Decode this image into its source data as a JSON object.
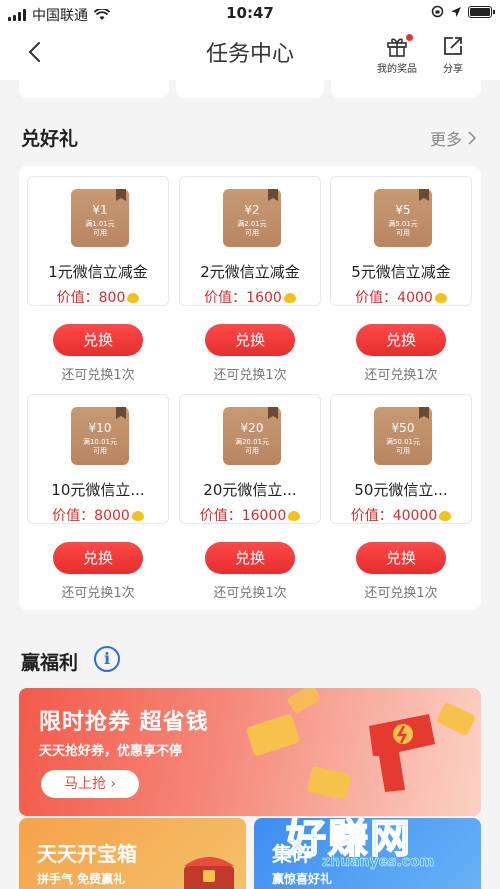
{
  "status_bar": {
    "carrier": "中国联通",
    "time": "10:47"
  },
  "nav": {
    "title": "任务中心",
    "prizes_label": "我的奖品",
    "share_label": "分享"
  },
  "gifts_section": {
    "title": "兑好礼",
    "more_label": "更多",
    "items": [
      {
        "coupon_amount": "¥1",
        "coupon_sub1": "满1.01元",
        "coupon_sub2": "可用",
        "name": "1元微信立减金",
        "value_label": "价值：800",
        "button": "兑换",
        "remaining": "还可兑换1次"
      },
      {
        "coupon_amount": "¥2",
        "coupon_sub1": "满2.01元",
        "coupon_sub2": "可用",
        "name": "2元微信立减金",
        "value_label": "价值：1600",
        "button": "兑换",
        "remaining": "还可兑换1次"
      },
      {
        "coupon_amount": "¥5",
        "coupon_sub1": "满5.01元",
        "coupon_sub2": "可用",
        "name": "5元微信立减金",
        "value_label": "价值：4000",
        "button": "兑换",
        "remaining": "还可兑换1次"
      },
      {
        "coupon_amount": "¥10",
        "coupon_sub1": "满10.01元",
        "coupon_sub2": "可用",
        "name": "10元微信立...",
        "value_label": "价值：8000",
        "button": "兑换",
        "remaining": "还可兑换1次"
      },
      {
        "coupon_amount": "¥20",
        "coupon_sub1": "满20.01元",
        "coupon_sub2": "可用",
        "name": "20元微信立...",
        "value_label": "价值：16000",
        "button": "兑换",
        "remaining": "还可兑换1次"
      },
      {
        "coupon_amount": "¥50",
        "coupon_sub1": "满50.01元",
        "coupon_sub2": "可用",
        "name": "50元微信立...",
        "value_label": "价值：40000",
        "button": "兑换",
        "remaining": "还可兑换1次"
      }
    ]
  },
  "benefits_section": {
    "title": "赢福利",
    "info_icon": "i",
    "banner": {
      "title": "限时抢券 超省钱",
      "subtitle": "天天抢好券，优惠享不停",
      "button": "马上抢"
    },
    "card_left": {
      "title": "天天开宝箱",
      "subtitle": "拼手气 免费赢礼"
    },
    "card_right": {
      "title": "集碎",
      "subtitle": "赢惊喜好礼"
    }
  },
  "watermark": {
    "main": "好赚网",
    "sub": "zhuanyes.com"
  },
  "colors": {
    "accent_red": "#e52d2d",
    "value_red": "#d62e2e",
    "info_blue": "#2e6fd6"
  }
}
